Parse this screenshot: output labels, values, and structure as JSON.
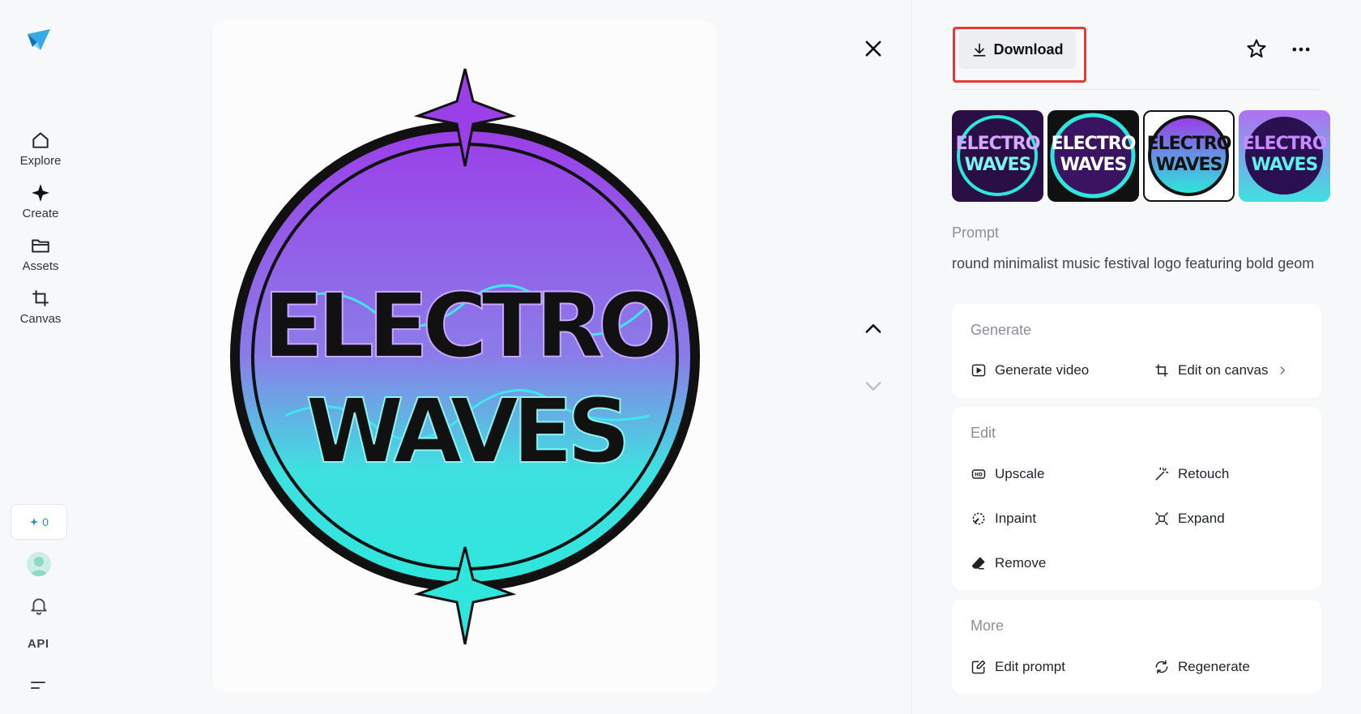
{
  "sidebar": {
    "nav": [
      {
        "label": "Explore",
        "icon": "home-icon"
      },
      {
        "label": "Create",
        "icon": "sparkle-icon"
      },
      {
        "label": "Assets",
        "icon": "folder-icon"
      },
      {
        "label": "Canvas",
        "icon": "crop-icon"
      }
    ],
    "credits": "0",
    "api_label": "API"
  },
  "image": {
    "line1": "ELECTRO",
    "line2": "WAVES"
  },
  "toolbar": {
    "download_label": "Download"
  },
  "thumbnails": [
    {
      "line1": "ELECTRO",
      "line2": "WAVES"
    },
    {
      "line1": "ELECTRO",
      "line2": "WAVES"
    },
    {
      "line1": "ELECTRO",
      "line2": "WAVES"
    },
    {
      "line1": "ELECTRO",
      "line2": "WAVES"
    }
  ],
  "prompt": {
    "label": "Prompt",
    "text": "round minimalist music festival logo featuring bold geom"
  },
  "generate": {
    "title": "Generate",
    "generate_video": "Generate video",
    "edit_on_canvas": "Edit on canvas"
  },
  "edit": {
    "title": "Edit",
    "upscale": "Upscale",
    "retouch": "Retouch",
    "inpaint": "Inpaint",
    "expand": "Expand",
    "remove": "Remove"
  },
  "more": {
    "title": "More",
    "edit_prompt": "Edit prompt",
    "regenerate": "Regenerate"
  },
  "colors": {
    "accent": "#2a8ec9",
    "purple": "#9b3fe8",
    "cyan": "#2ee6dc",
    "highlight": "#e53935"
  }
}
